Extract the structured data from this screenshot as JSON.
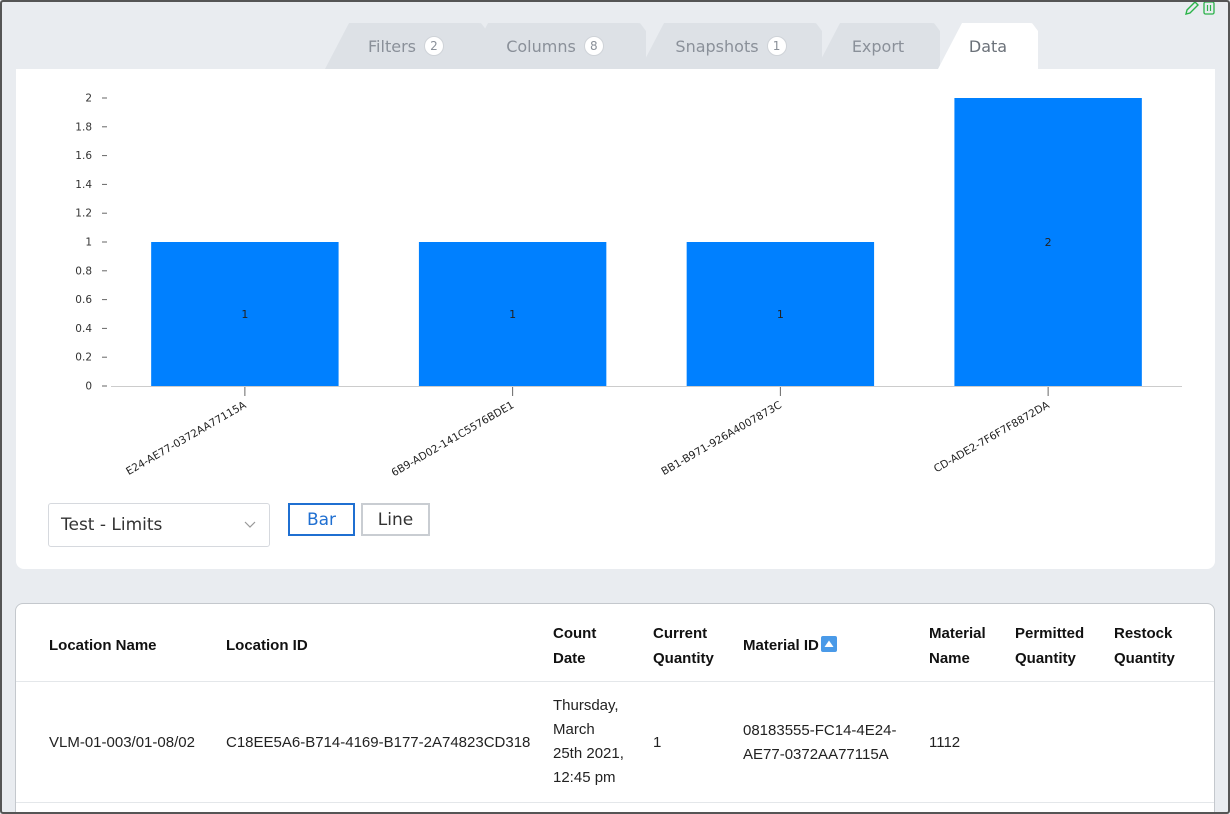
{
  "tabs": [
    {
      "label": "Filters",
      "badge": "2"
    },
    {
      "label": "Columns",
      "badge": "8"
    },
    {
      "label": "Snapshots",
      "badge": "1"
    },
    {
      "label": "Export"
    },
    {
      "label": "Data"
    }
  ],
  "chart_data": {
    "type": "bar",
    "categories": [
      "08183555-FC14-4E24-AE77-0372AA77115A",
      "…6B9-AD02-141C5576BDE1",
      "…BB1-B971-926A4007873C",
      "…CD-ADE2-7F6F7F8872DA"
    ],
    "category_labels_visible": [
      "E24-AE77-0372AA77115A",
      "6B9-AD02-141C5576BDE1",
      "BB1-B971-926A4007873C",
      "CD-ADE2-7F6F7F8872DA"
    ],
    "values": [
      1,
      1,
      1,
      2
    ],
    "ylim": [
      0,
      2
    ],
    "yticks": [
      "0",
      "0.2",
      "0.4",
      "0.6",
      "0.8",
      "1",
      "1.2",
      "1.4",
      "1.6",
      "1.8",
      "2"
    ],
    "bar_color": "#0080ff",
    "grid": false
  },
  "controls": {
    "select_value": "Test - Limits",
    "bar_label": "Bar",
    "line_label": "Line"
  },
  "table": {
    "headers": {
      "location_name": "Location Name",
      "location_id": "Location ID",
      "count_date_1": "Count",
      "count_date_2": "Date",
      "current_qty_1": "Current",
      "current_qty_2": "Quantity",
      "material_id": "Material ID",
      "material_name_1": "Material",
      "material_name_2": "Name",
      "permitted_qty_1": "Permitted",
      "permitted_qty_2": "Quantity",
      "restock_qty_1": "Restock",
      "restock_qty_2": "Quantity"
    },
    "row": {
      "location_name": "VLM-01-003/01-08/02",
      "location_id": "C18EE5A6-B714-4169-B177-2A74823CD318",
      "count_date_1": "Thursday,",
      "count_date_2": "March",
      "count_date_3": "25th 2021,",
      "count_date_4": "12:45 pm",
      "current_qty": "1",
      "material_id_1": "08183555-FC14-4E24-",
      "material_id_2": "AE77-0372AA77115A",
      "material_name": "1112"
    }
  },
  "colors": {
    "accent": "#1f6fd1",
    "bar": "#0080ff",
    "edit_icon": "#2bb34a"
  }
}
